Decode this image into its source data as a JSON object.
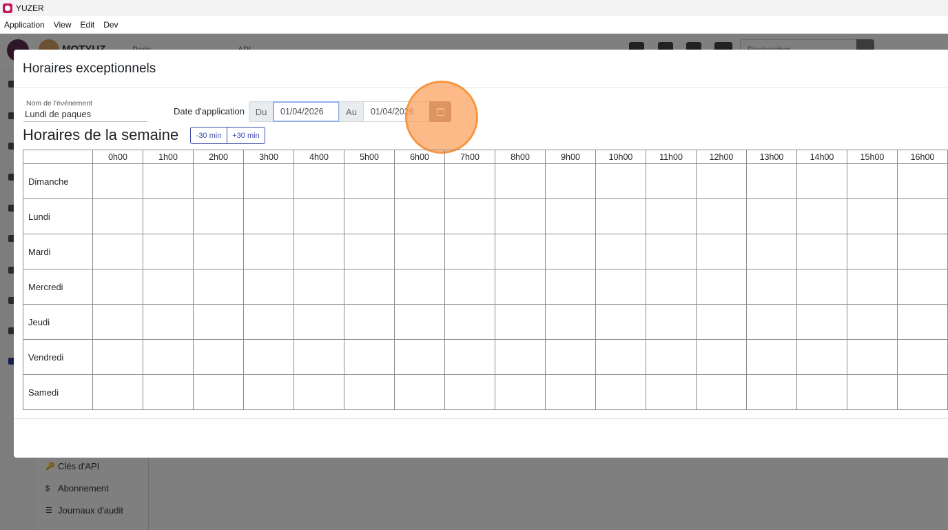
{
  "window": {
    "title": "YUZER"
  },
  "menubar": [
    "Application",
    "View",
    "Edit",
    "Dev"
  ],
  "background": {
    "org": "MOTYUZ",
    "city": "Paris",
    "api": "API",
    "search_placeholder": "Rechercher",
    "subnav": [
      {
        "icon": "key-icon",
        "glyph": "🔑",
        "label": "Clés d'API"
      },
      {
        "icon": "dollar-icon",
        "glyph": "$",
        "label": "Abonnement"
      },
      {
        "icon": "list-icon",
        "glyph": "☰",
        "label": "Journaux d'audit"
      }
    ]
  },
  "modal": {
    "title": "Horaires exceptionnels",
    "event_label": "Nom de l'événement",
    "event_value": "Lundi de paques",
    "date_label": "Date d'application",
    "from_label": "Du",
    "from_value": "01/04/2026",
    "to_label": "Au",
    "to_value": "01/04/2026",
    "week_title": "Horaires de la semaine",
    "minus_label": "-30 min",
    "plus_label": "+30 min",
    "hours": [
      "0h00",
      "1h00",
      "2h00",
      "3h00",
      "4h00",
      "5h00",
      "6h00",
      "7h00",
      "8h00",
      "9h00",
      "10h00",
      "11h00",
      "12h00",
      "13h00",
      "14h00",
      "15h00",
      "16h00"
    ],
    "days": [
      "Dimanche",
      "Lundi",
      "Mardi",
      "Mercredi",
      "Jeudi",
      "Vendredi",
      "Samedi"
    ]
  }
}
